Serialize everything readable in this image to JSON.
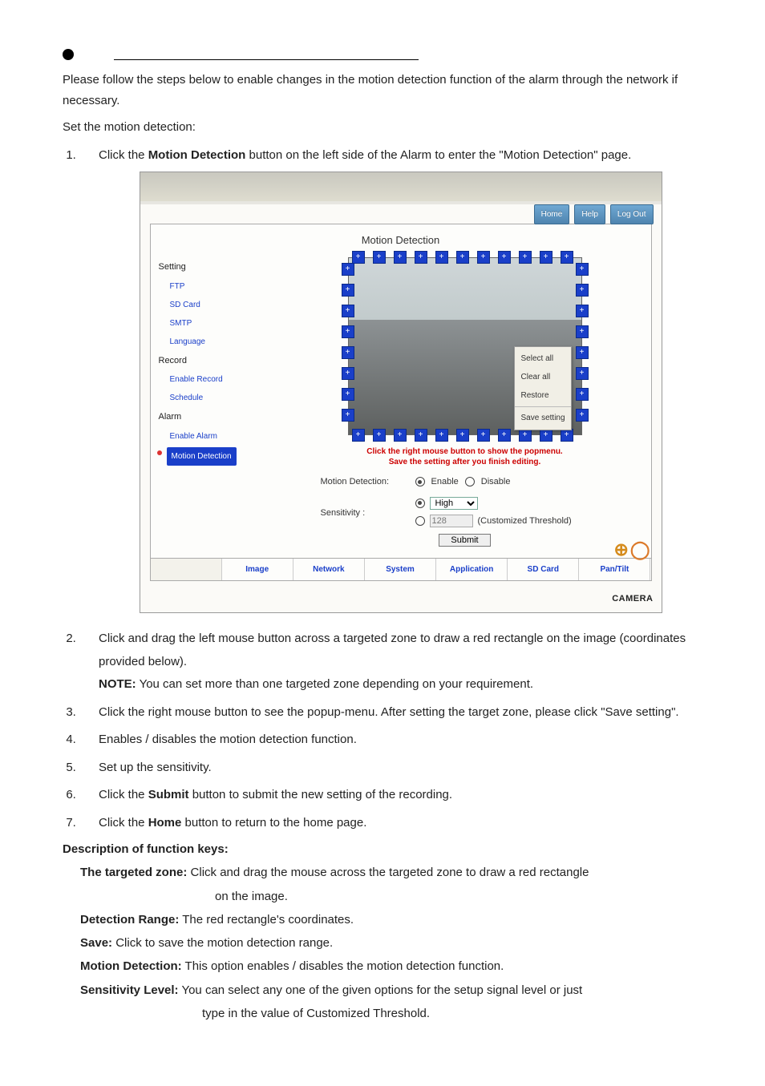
{
  "intro": {
    "p1": "Please follow the steps below to enable changes in the motion detection function of the alarm through the network if necessary.",
    "p2": "Set the motion detection:"
  },
  "steps": {
    "s1_a": "Click the ",
    "s1_b": "Motion Detection",
    "s1_c": " button on the left side of the Alarm to enter the \"Motion Detection\" page.",
    "s2_a": "Click and drag the left mouse button across a targeted zone to draw a red rectangle on the image (coordinates provided below).",
    "s2_note_label": "NOTE:",
    "s2_note": " You can set more than one targeted zone depending on your requirement.",
    "s3": "Click the right mouse button to see the popup-menu. After setting the target zone, please click \"Save setting\".",
    "s4": "Enables / disables the motion detection function.",
    "s5": "Set up the sensitivity.",
    "s6_a": "Click the ",
    "s6_b": "Submit",
    "s6_c": " button to submit the new setting of the recording.",
    "s7_a": "Click the ",
    "s7_b": "Home",
    "s7_c": " button to return to the home page."
  },
  "shot": {
    "top_links": {
      "home": "Home",
      "help": "Help",
      "logout": "Log Out"
    },
    "title": "Motion Detection",
    "sidebar": {
      "setting": "Setting",
      "items1": [
        "FTP",
        "SD Card",
        "SMTP",
        "Language"
      ],
      "record": "Record",
      "items2": [
        "Enable Record",
        "Schedule"
      ],
      "alarm": "Alarm",
      "enable_alarm": "Enable Alarm",
      "motion_detection": "Motion Detection"
    },
    "ctx": {
      "a": "Select all",
      "b": "Clear all",
      "c": "Restore",
      "d": "Save setting"
    },
    "warn1": "Click the right mouse button to show the popmenu.",
    "warn2": "Save the setting after you finish editing.",
    "controls": {
      "md_label": "Motion Detection:",
      "enable": "Enable",
      "disable": "Disable",
      "sens_label": "Sensitivity :",
      "sens_value": "High",
      "thresh_value": "128",
      "thresh_note": "(Customized Threshold)"
    },
    "submit": "Submit",
    "tabs": [
      "",
      "Image",
      "Network",
      "System",
      "Application",
      "SD Card",
      "Pan/Tilt"
    ],
    "camera": "CAMERA"
  },
  "desc": {
    "heading": "Description of function keys:",
    "items": {
      "tz_label": "The targeted zone:",
      "tz_text": " Click and drag the mouse across the targeted zone to draw a red rectangle",
      "tz_cont": "on the image.",
      "dr_label": "Detection Range:",
      "dr_text": " The red rectangle's coordinates.",
      "sv_label": "Save:",
      "sv_text": " Click to save the motion detection range.",
      "md_label": "Motion Detection:",
      "md_text": " This option enables / disables the motion detection function.",
      "sl_label": "Sensitivity Level:",
      "sl_text": " You can select any one of the given options for the setup signal level or just",
      "sl_cont": "type in the value of Customized Threshold."
    }
  }
}
